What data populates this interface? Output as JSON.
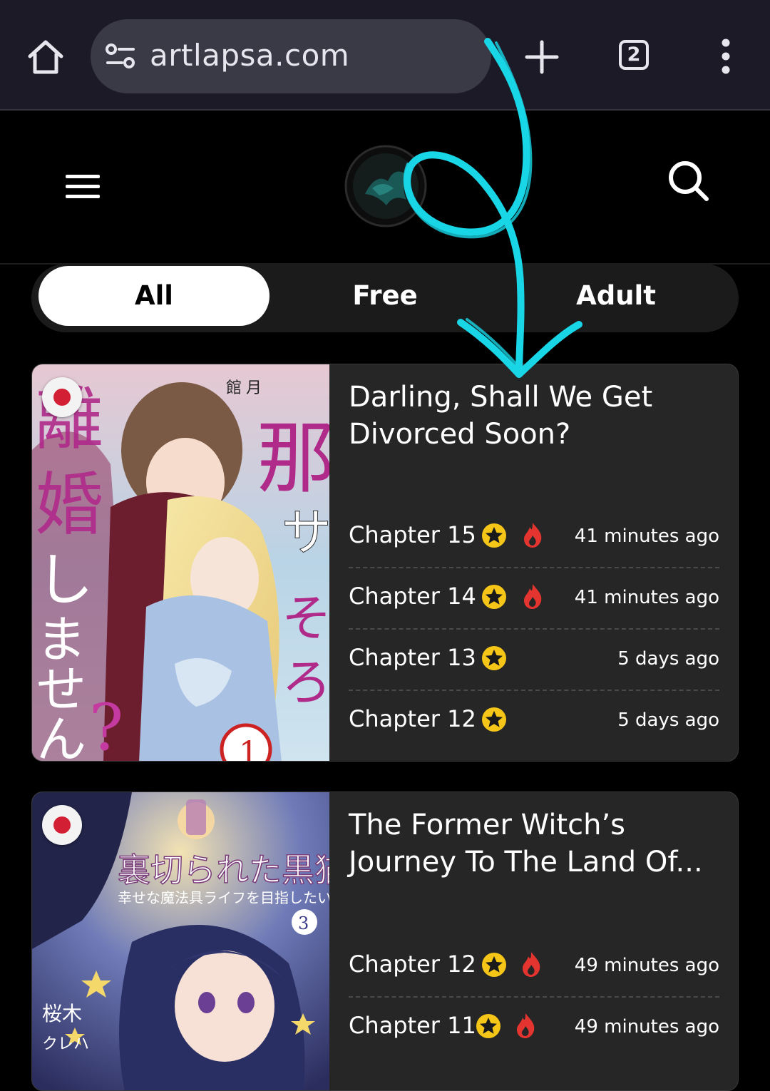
{
  "browser": {
    "url": "artlapsa.com",
    "tab_count": "2",
    "icons": [
      "home-icon",
      "site-settings-icon",
      "plus-icon",
      "tab-switcher-icon",
      "more-vert-icon"
    ]
  },
  "header": {
    "icons": [
      "hamburger-icon",
      "site-logo",
      "search-icon"
    ]
  },
  "filters": {
    "all": "All",
    "free": "Free",
    "adult": "Adult",
    "active": "All"
  },
  "cards": [
    {
      "title": "Darling, Shall We Get Divorced Soon?",
      "flag": "japan-flag-icon",
      "chapters": [
        {
          "name": "Chapter 15",
          "time": "41 minutes ago",
          "hot": true
        },
        {
          "name": "Chapter 14",
          "time": "41 minutes ago",
          "hot": true
        },
        {
          "name": "Chapter 13",
          "time": "5 days ago",
          "hot": false
        },
        {
          "name": "Chapter 12",
          "time": "5 days ago",
          "hot": false
        }
      ]
    },
    {
      "title": "The Former Witch’s Journey To The Land Of...",
      "flag": "japan-flag-icon",
      "chapters": [
        {
          "name": "Chapter 12",
          "time": "49 minutes ago",
          "hot": true
        },
        {
          "name": "Chapter 11",
          "time": "49 minutes ago",
          "hot": true
        }
      ]
    }
  ],
  "colors": {
    "annotation_stroke": "#19d6e6",
    "star": "#f5c518",
    "fire": "#e3342f",
    "card_bg": "#262626"
  }
}
